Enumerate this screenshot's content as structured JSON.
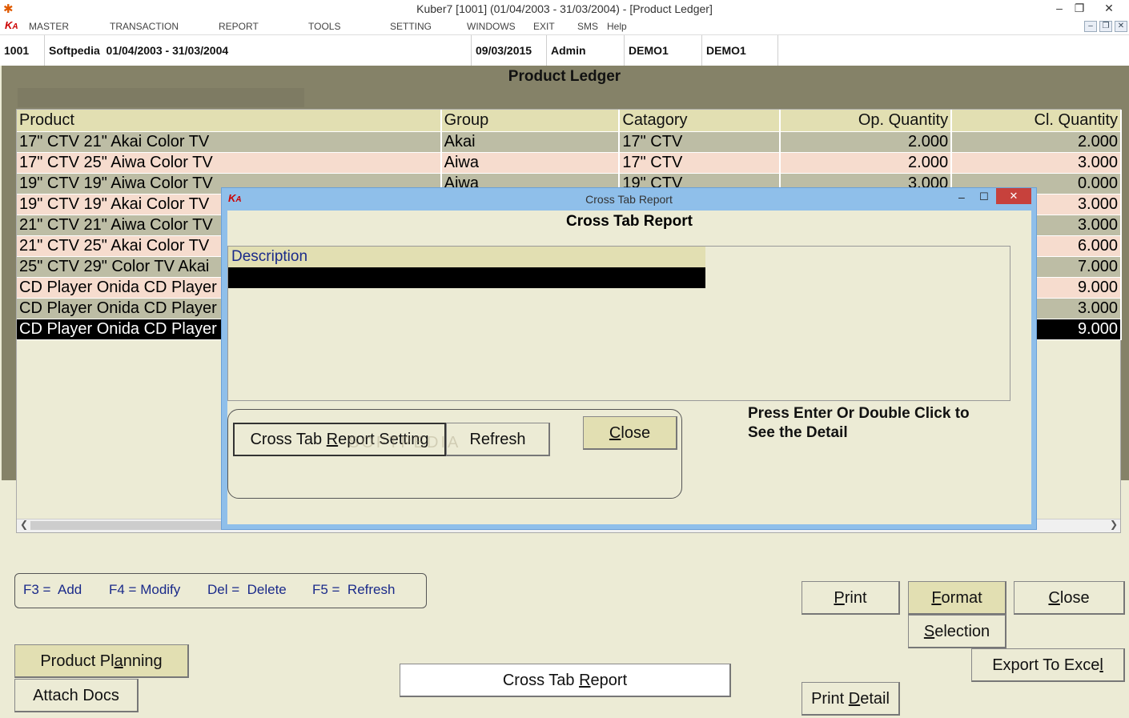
{
  "window": {
    "title": "Kuber7 [1001] (01/04/2003 - 31/03/2004) - [Product Ledger]"
  },
  "menu": [
    "MASTER",
    "TRANSACTION",
    "REPORT",
    "TOOLS",
    "SETTING",
    "WINDOWS",
    "EXIT",
    "SMS",
    "Help"
  ],
  "status": {
    "code": "1001",
    "company": "Softpedia  01/04/2003 - 31/03/2004",
    "date": "09/03/2015",
    "user": "Admin",
    "db1": "DEMO1",
    "db2": "DEMO1"
  },
  "page": {
    "title": "Product Ledger"
  },
  "grid": {
    "columns": [
      "Product",
      "Group",
      "Catagory",
      "Op. Quantity",
      "Cl. Quantity"
    ],
    "rows": [
      {
        "product": "17\" CTV  21\" Akai Color TV",
        "group": "Akai",
        "category": "17\" CTV",
        "op": "2.000",
        "cl": "2.000"
      },
      {
        "product": "17\" CTV  25\" Aiwa Color TV",
        "group": "Aiwa",
        "category": "17\" CTV",
        "op": "2.000",
        "cl": "3.000"
      },
      {
        "product": "19\" CTV  19\" Aiwa Color TV",
        "group": "Aiwa",
        "category": "19\" CTV",
        "op": "3.000",
        "cl": "0.000"
      },
      {
        "product": "19\" CTV  19\" Akai Color TV",
        "group": "",
        "category": "",
        "op": "",
        "cl": "3.000"
      },
      {
        "product": "21\" CTV  21\" Aiwa Color TV",
        "group": "",
        "category": "",
        "op": "",
        "cl": "3.000"
      },
      {
        "product": "21\" CTV  25\" Akai Color TV",
        "group": "",
        "category": "",
        "op": "",
        "cl": "6.000"
      },
      {
        "product": "25\" CTV  29\" Color TV Akai",
        "group": "",
        "category": "",
        "op": "",
        "cl": "7.000"
      },
      {
        "product": "CD Player  Onida CD Player",
        "group": "",
        "category": "",
        "op": "",
        "cl": "9.000"
      },
      {
        "product": "CD Player  Onida CD Player",
        "group": "",
        "category": "",
        "op": "",
        "cl": "3.000"
      },
      {
        "product": "CD Player  Onida CD Player",
        "group": "",
        "category": "",
        "op": "",
        "cl": "9.000"
      }
    ]
  },
  "dialog": {
    "title": "Cross Tab Report",
    "heading": "Cross Tab Report",
    "list_header": "Description",
    "hint_line1": "Press Enter Or Double Click to",
    "hint_line2": "See the Detail",
    "btn_setting": {
      "pre": "Cross Tab ",
      "acc": "R",
      "post": "eport Setting"
    },
    "btn_refresh": "Refresh",
    "btn_close": {
      "pre": "",
      "acc": "C",
      "post": "lose"
    },
    "watermark": "SOFTPEDIA"
  },
  "shortcuts": [
    "F3 =  Add",
    "F4 = Modify",
    "Del =  Delete",
    "F5 =  Refresh"
  ],
  "buttons": {
    "product_planning": {
      "pre": "Product Pl",
      "acc": "a",
      "post": "nning"
    },
    "attach_docs": "Attach Docs",
    "cross_tab": {
      "pre": "Cross Tab ",
      "acc": "R",
      "post": "eport"
    },
    "print": {
      "pre": "",
      "acc": "P",
      "post": "rint"
    },
    "format": {
      "pre": "",
      "acc": "F",
      "post": "ormat"
    },
    "close": {
      "pre": "",
      "acc": "C",
      "post": "lose"
    },
    "selection": {
      "pre": "",
      "acc": "S",
      "post": "election"
    },
    "export": {
      "pre": "Export To Exce",
      "acc": "l",
      "post": ""
    },
    "print_detail": {
      "pre": "Print ",
      "acc": "D",
      "post": "etail"
    }
  }
}
